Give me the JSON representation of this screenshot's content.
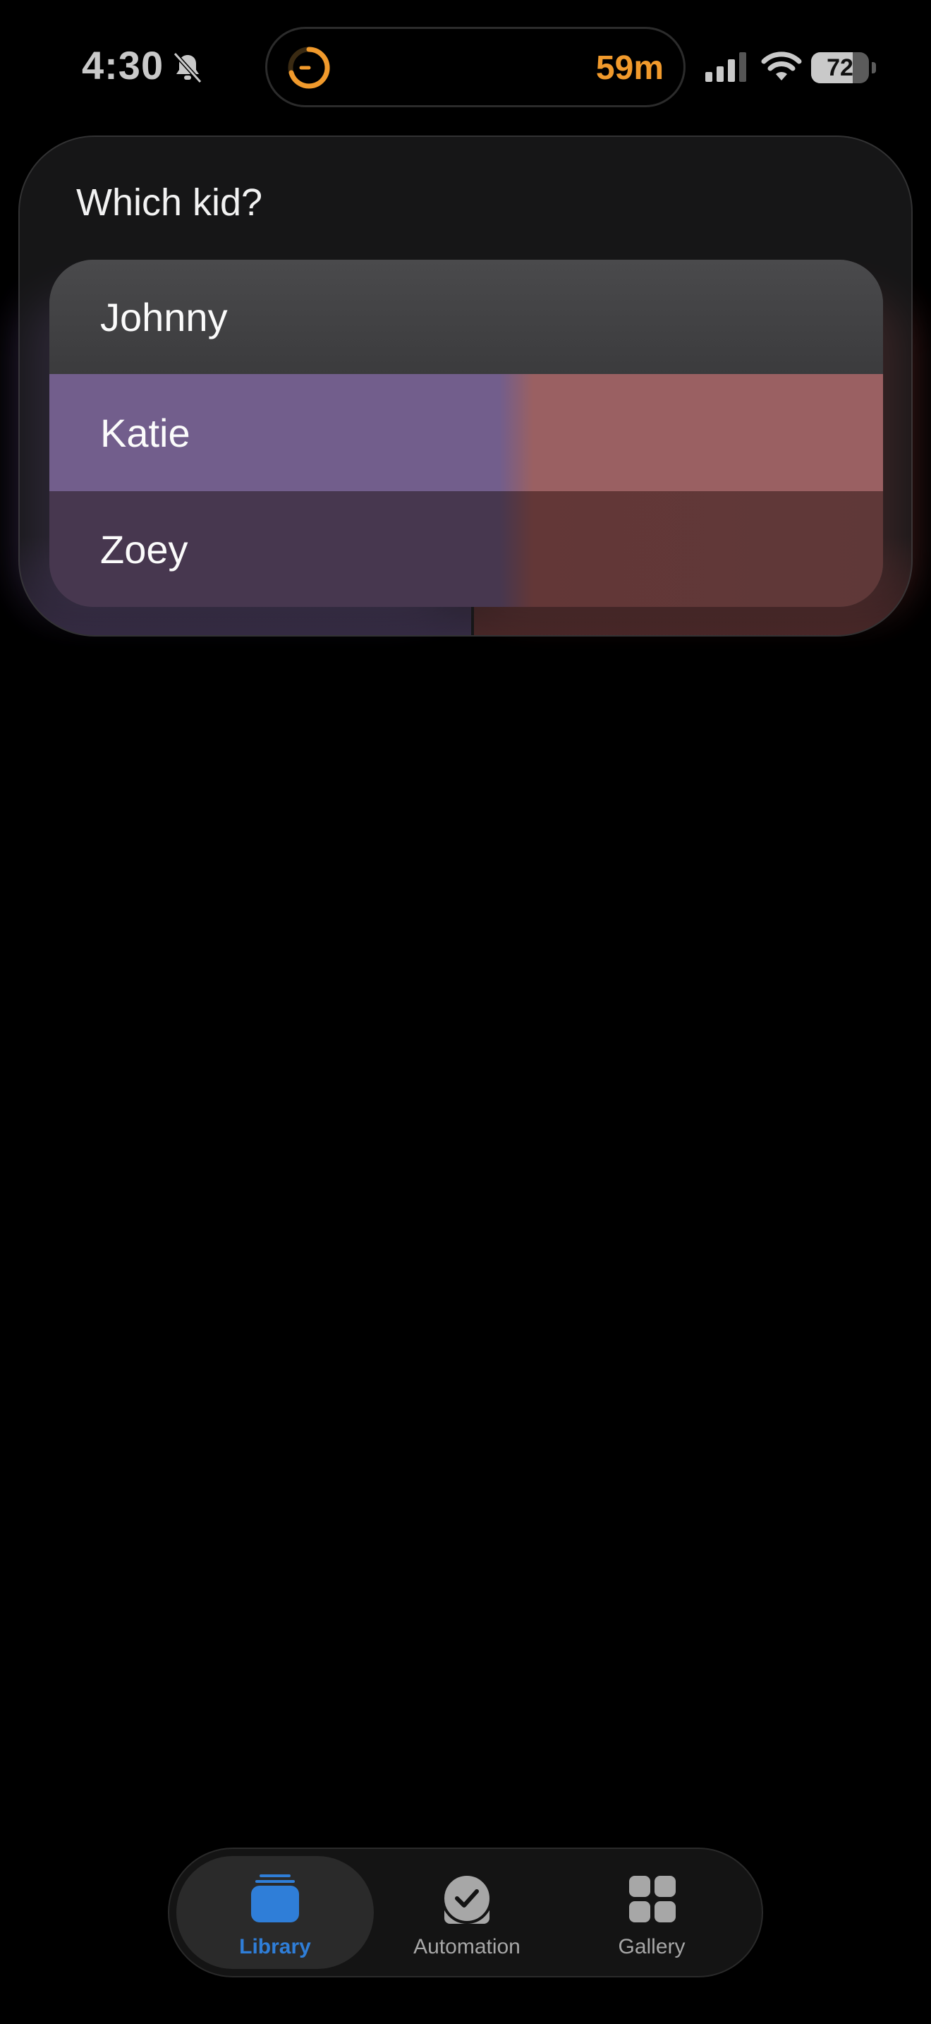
{
  "status_bar": {
    "time": "4:30",
    "island_timer": "59m",
    "battery_level": "72",
    "battery_fraction": 0.72
  },
  "colors": {
    "accent_blue": "#2f7ed8",
    "timer_orange": "#f19a2c"
  },
  "prompt": {
    "title": "Which kid?",
    "options": [
      {
        "label": "Johnny"
      },
      {
        "label": "Katie"
      },
      {
        "label": "Zoey"
      }
    ]
  },
  "tab_bar": {
    "selected": "Library",
    "tabs": [
      {
        "label": "Library",
        "icon": "library-stack-icon"
      },
      {
        "label": "Automation",
        "icon": "clock-check-icon"
      },
      {
        "label": "Gallery",
        "icon": "grid-icon"
      }
    ]
  }
}
